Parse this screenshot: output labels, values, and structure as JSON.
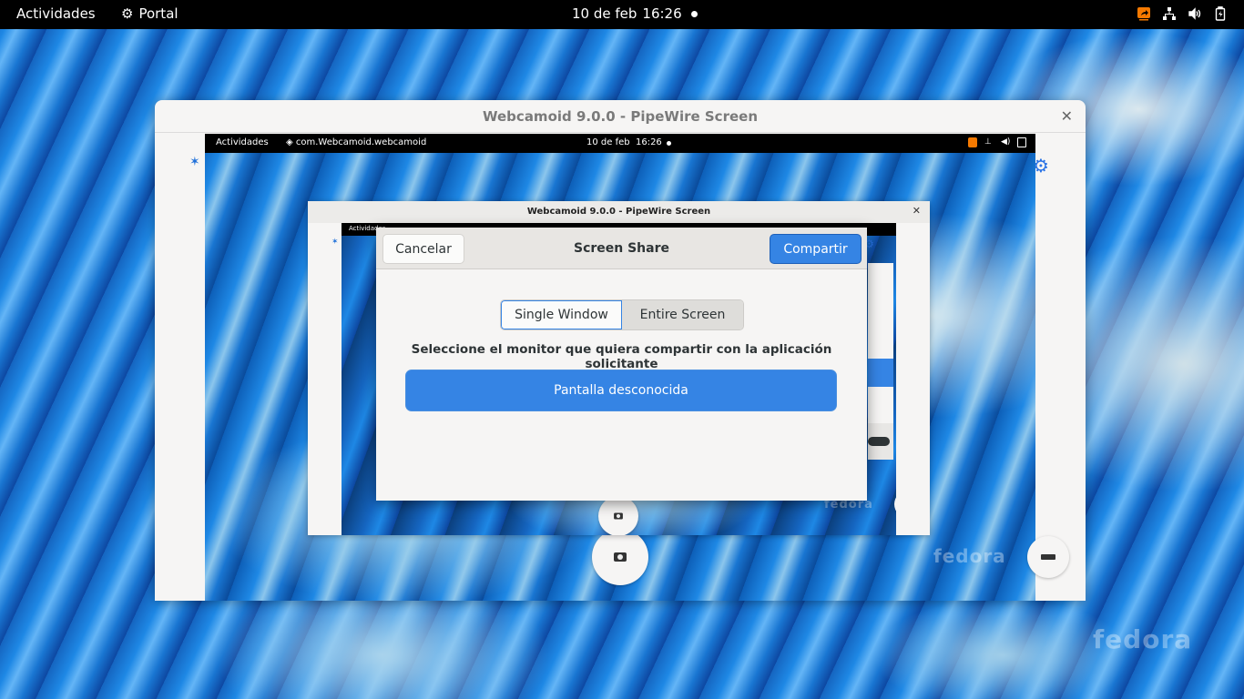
{
  "topbar": {
    "activities": "Actividades",
    "app_name": "Portal",
    "date": "10 de feb",
    "time": "16:26",
    "tray_icons": [
      "screen-share-indicator-icon",
      "network-wired-icon",
      "volume-icon",
      "battery-charging-icon"
    ]
  },
  "outer_window": {
    "title": "Webcamoid 9.0.0 - PipeWire Screen",
    "close_glyph": "✕",
    "inner_topbar": {
      "activities": "Actividades",
      "app_name": "com.Webcamoid.webcamoid",
      "date": "10 de feb",
      "time": "16:26"
    }
  },
  "middle_window": {
    "title": "Webcamoid 9.0.0 - PipeWire Screen",
    "close_glyph": "✕",
    "inner_topbar_activities": "Actividades"
  },
  "dialog": {
    "cancel_label": "Cancelar",
    "title": "Screen Share",
    "share_label": "Compartir",
    "tabs": [
      {
        "label": "Single Window",
        "selected": true
      },
      {
        "label": "Entire Screen",
        "selected": false
      }
    ],
    "prompt": "Seleccione el monitor que quiera compartir con la aplicación solicitante",
    "monitors": [
      {
        "label": "Pantalla desconocida",
        "selected": true
      }
    ]
  },
  "watermark": "fedora",
  "colors": {
    "accent": "#3584e4",
    "topbar": "#000000",
    "window_bg": "#f6f5f4",
    "tray_indicator": "#f57900"
  }
}
